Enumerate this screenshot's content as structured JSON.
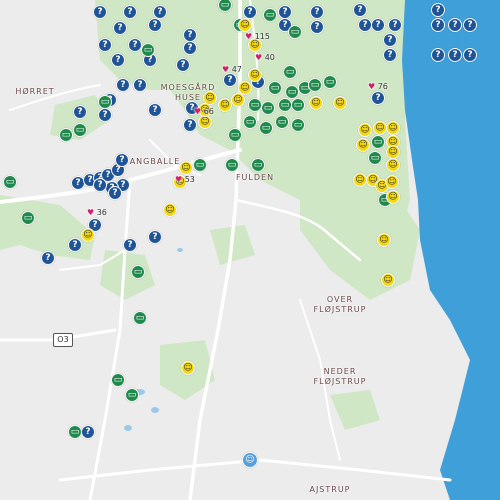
{
  "map": {
    "place_labels": [
      {
        "lines": [
          "HØRRET"
        ]
      },
      {
        "lines": [
          "MOESGÅRD",
          "HUSE"
        ]
      },
      {
        "lines": [
          "ANGBALLE"
        ]
      },
      {
        "lines": [
          "FULDEN"
        ]
      },
      {
        "lines": [
          "OVER",
          "FLØJSTRUP"
        ]
      },
      {
        "lines": [
          "NEDER",
          "FLØJSTRUP"
        ]
      },
      {
        "lines": [
          "AJSTRUP"
        ]
      }
    ],
    "road_number": "O3",
    "favorite_counts": [
      "115",
      "40",
      "47",
      "66",
      "76",
      "53",
      "36"
    ],
    "marker_types": {
      "q": {
        "icon": "question-mark-icon",
        "glyph": "?",
        "color": "#1f5496"
      },
      "g": {
        "icon": "cache-box-icon",
        "glyph": "▭",
        "color": "#1f8a4c"
      },
      "s": {
        "icon": "smiley-icon",
        "glyph": "☺",
        "color": "#f3d814"
      },
      "b": {
        "icon": "event-smiley-icon",
        "glyph": "☺",
        "color": "#5aa0d8"
      }
    },
    "colors": {
      "land": "#ececec",
      "forest": "#cfe7c4",
      "water": "#3f9fd9",
      "road": "#ffffff",
      "heart": "#d11f6e"
    }
  }
}
